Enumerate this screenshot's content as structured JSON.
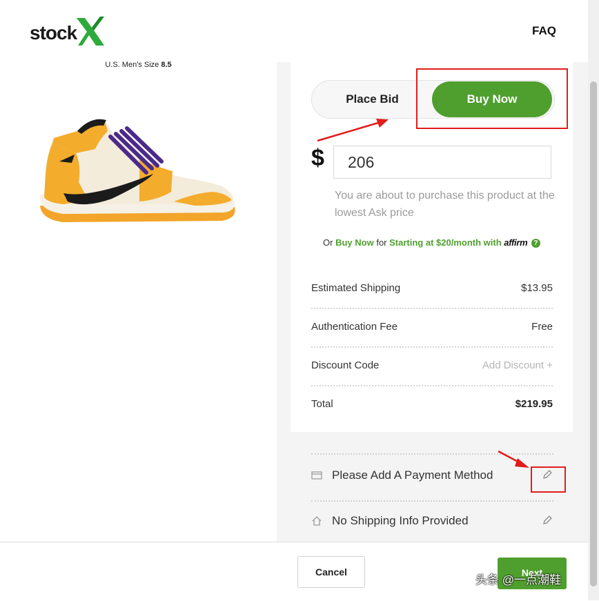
{
  "header": {
    "logo_text": "stock",
    "faq": "FAQ"
  },
  "product": {
    "size_prefix": "U.S. Men's Size",
    "size_value": "8.5",
    "image": "sneaker-image"
  },
  "order_type": {
    "place_bid": "Place Bid",
    "buy_now": "Buy Now",
    "active": "Buy Now"
  },
  "price": {
    "currency": "$",
    "value": "206",
    "hint": "You are about to purchase this product at the lowest Ask price"
  },
  "affirm": {
    "prefix": "Or",
    "buy_now": "Buy Now",
    "for": "for",
    "starting": "Starting at $20/month with",
    "brand": "affirm",
    "help_icon": "question-icon"
  },
  "summary": [
    {
      "label": "Estimated Shipping",
      "value": "$13.95"
    },
    {
      "label": "Authentication Fee",
      "value": "Free"
    },
    {
      "label": "Discount Code",
      "value": "Add Discount +"
    },
    {
      "label": "Total",
      "value": "$219.95"
    }
  ],
  "payment": {
    "text": "Please Add A Payment Method",
    "icon": "credit-card-icon",
    "edit_icon": "pencil-icon"
  },
  "shipping": {
    "text": "No Shipping Info Provided",
    "icon": "home-icon",
    "edit_icon": "pencil-icon"
  },
  "footer": {
    "cancel": "Cancel",
    "next": "Next"
  },
  "watermark": "头条 @一点潮鞋",
  "colors": {
    "brand_green": "#4f9f2f",
    "annotation_red": "#e21b1b",
    "logo_green": "#2eaa3c"
  }
}
